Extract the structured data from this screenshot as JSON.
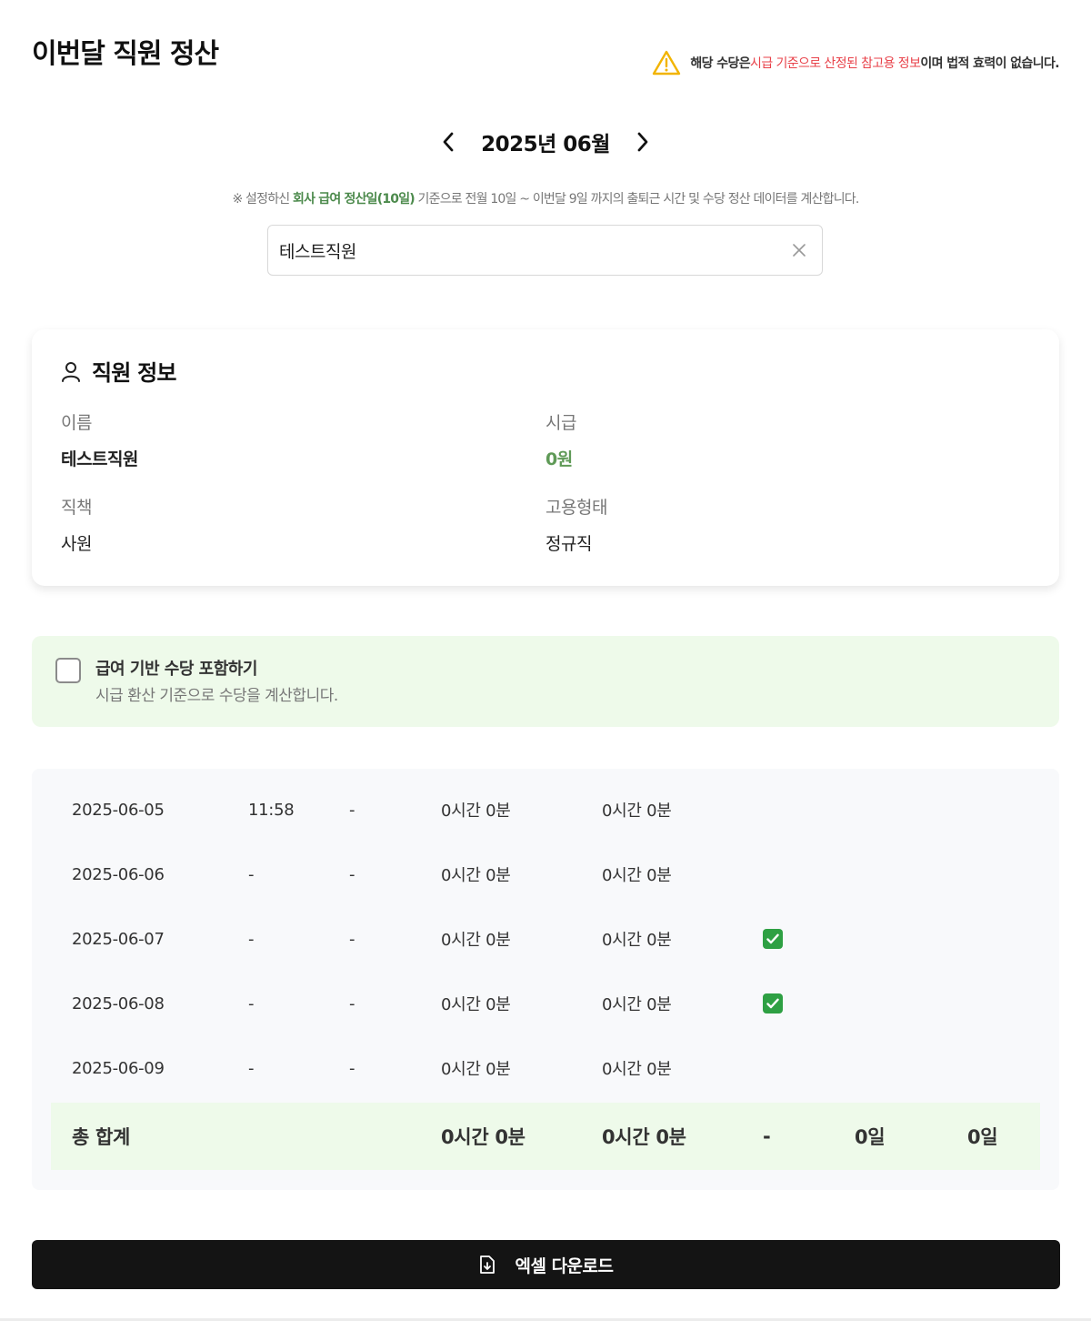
{
  "header": {
    "title": "이번달 직원 정산",
    "notice": {
      "prefix": "해당 수당은 ",
      "highlight": "시급 기준으로 산정된 참고용 정보",
      "suffix": "이며 법적 효력이 없습니다."
    }
  },
  "month_nav": {
    "label": "2025년 06월"
  },
  "period_note": {
    "prefix": "※ 설정하신 ",
    "highlight": "회사 급여 정산일(10일)",
    "suffix": " 기준으로 전월 10일 ~ 이번달 9일 까지의 출퇴근 시간 및 수당 정산 데이터를 계산합니다."
  },
  "search": {
    "value": "테스트직원"
  },
  "employee_card": {
    "title": "직원 정보",
    "name_label": "이름",
    "name_value": "테스트직원",
    "wage_label": "시급",
    "wage_value": "0원",
    "position_label": "직책",
    "position_value": "사원",
    "employment_label": "고용형태",
    "employment_value": "정규직"
  },
  "allowance": {
    "title": "급여 기반 수당 포함하기",
    "description": "시급 환산 기준으로 수당을 계산합니다.",
    "checked": false
  },
  "table": {
    "rows": [
      {
        "date": "2025-06-05",
        "in": "11:58",
        "out": "-",
        "work": "0시간 0분",
        "extra": "0시간 0분",
        "check": false
      },
      {
        "date": "2025-06-06",
        "in": "-",
        "out": "-",
        "work": "0시간 0분",
        "extra": "0시간 0분",
        "check": false
      },
      {
        "date": "2025-06-07",
        "in": "-",
        "out": "-",
        "work": "0시간 0분",
        "extra": "0시간 0분",
        "check": true
      },
      {
        "date": "2025-06-08",
        "in": "-",
        "out": "-",
        "work": "0시간 0분",
        "extra": "0시간 0분",
        "check": true
      },
      {
        "date": "2025-06-09",
        "in": "-",
        "out": "-",
        "work": "0시간 0분",
        "extra": "0시간 0분",
        "check": false
      }
    ],
    "total": {
      "label": "총 합계",
      "work": "0시간 0분",
      "extra": "0시간 0분",
      "dash": "-",
      "days1": "0일",
      "days2": "0일"
    }
  },
  "download_button": {
    "label": "엑셀 다운로드"
  },
  "colors": {
    "accent_green": "#5f9a57",
    "warning_red": "#e8424a",
    "warning_yellow": "#f2b400",
    "highlight_bg": "#eefaea"
  }
}
